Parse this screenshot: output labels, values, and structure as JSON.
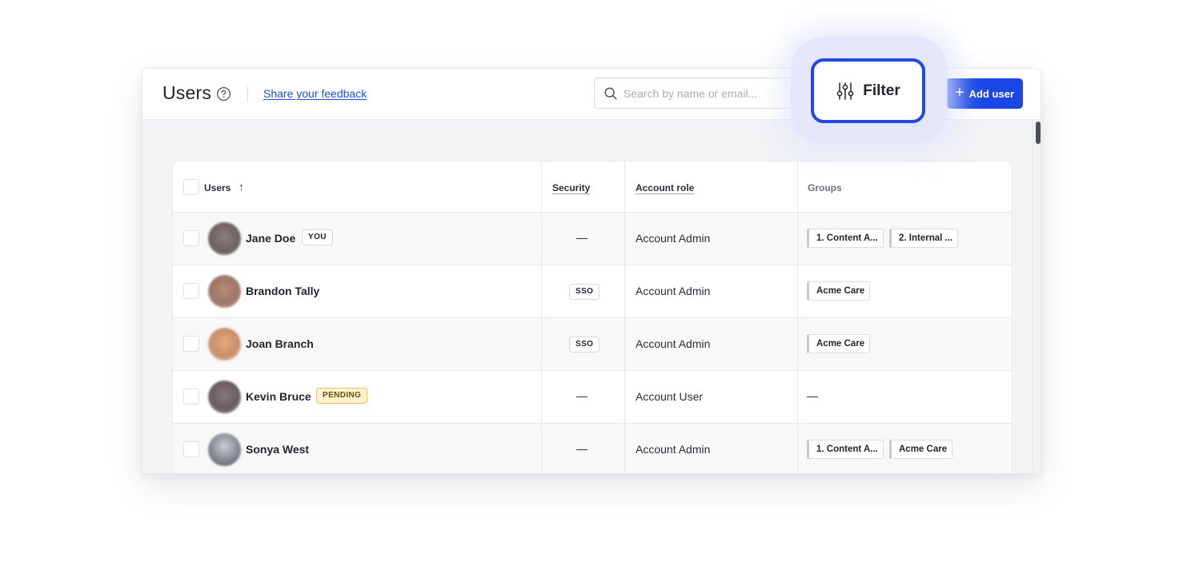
{
  "header": {
    "title": "Users",
    "feedback_link": "Share your feedback",
    "search_placeholder": "Search by name or email...",
    "filter_label": "Filter",
    "add_user_label": "Add user"
  },
  "table": {
    "columns": {
      "users": "Users",
      "security": "Security",
      "role": "Account role",
      "groups": "Groups"
    },
    "rows": [
      {
        "name": "Jane Doe",
        "badge": "YOU",
        "security": "—",
        "role": "Account Admin",
        "groups": [
          "1. Content A...",
          "2. Internal ..."
        ]
      },
      {
        "name": "Brandon Tally",
        "badge": "",
        "security": "SSO",
        "role": "Account Admin",
        "groups": [
          "Acme Care"
        ]
      },
      {
        "name": "Joan Branch",
        "badge": "",
        "security": "SSO",
        "role": "Account Admin",
        "groups": [
          "Acme Care"
        ]
      },
      {
        "name": "Kevin Bruce",
        "badge": "PENDING",
        "security": "—",
        "role": "Account User",
        "groups_empty": "—"
      },
      {
        "name": "Sonya West",
        "badge": "",
        "security": "—",
        "role": "Account Admin",
        "groups": [
          "1. Content A...",
          "Acme Care"
        ]
      }
    ]
  },
  "colors": {
    "accent": "#1a47e6",
    "filter_highlight_border": "#2049e3",
    "link": "#1f4fd6",
    "pending_badge_bg": "#fdf3cf"
  }
}
